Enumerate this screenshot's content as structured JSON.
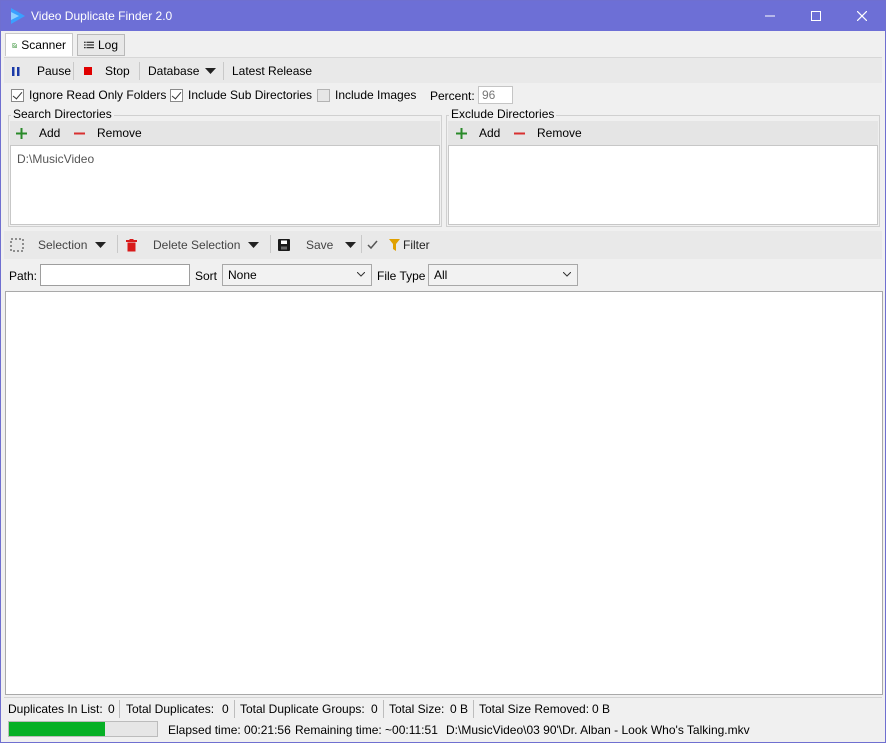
{
  "window": {
    "title": "Video Duplicate Finder 2.0"
  },
  "tabs": [
    {
      "label": "Scanner",
      "icon": "scanner-icon",
      "active": true
    },
    {
      "label": "Log",
      "icon": "list-icon",
      "active": false
    }
  ],
  "toolbar": {
    "pause": "Pause",
    "stop": "Stop",
    "database": "Database",
    "latest_release": "Latest Release"
  },
  "options": {
    "ignore_read_only": {
      "label": "Ignore Read Only Folders",
      "checked": true
    },
    "include_sub_dirs": {
      "label": "Include Sub Directories",
      "checked": true
    },
    "include_images": {
      "label": "Include Images",
      "checked": false
    },
    "percent_label": "Percent:",
    "percent_value": "96"
  },
  "search_directories": {
    "title": "Search Directories",
    "add": "Add",
    "remove": "Remove",
    "items": [
      "D:\\MusicVideo"
    ]
  },
  "exclude_directories": {
    "title": "Exclude Directories",
    "add": "Add",
    "remove": "Remove",
    "items": []
  },
  "results_toolbar": {
    "selection": "Selection",
    "delete_selection": "Delete Selection",
    "save": "Save",
    "filter": "Filter"
  },
  "filters": {
    "path_label": "Path:",
    "path_value": "",
    "sort_label": "Sort",
    "sort_value": "None",
    "file_type_label": "File Type",
    "file_type_value": "All"
  },
  "status": {
    "duplicates_in_list_label": "Duplicates In List:",
    "duplicates_in_list": "0",
    "total_duplicates_label": "Total Duplicates:",
    "total_duplicates": "0",
    "total_groups_label": "Total Duplicate Groups:",
    "total_groups": "0",
    "total_size_label": "Total Size:",
    "total_size": "0 B",
    "total_removed_label": "Total Size Removed:",
    "total_removed": "0 B"
  },
  "progress": {
    "percent": 65,
    "elapsed": "Elapsed time: 00:21:56",
    "remaining": "Remaining time: ~00:11:51",
    "current_file": "D:\\MusicVideo\\03 90'\\Dr. Alban - Look Who's Talking.mkv"
  },
  "colors": {
    "titlebar": "#6d6fd6",
    "progress_fill": "#06b025",
    "add_icon": "#2a8a2a",
    "remove_icon": "#d83030",
    "stop_icon": "#e00000",
    "pause_icon": "#1a3aa8",
    "filter_icon": "#e0a000"
  }
}
